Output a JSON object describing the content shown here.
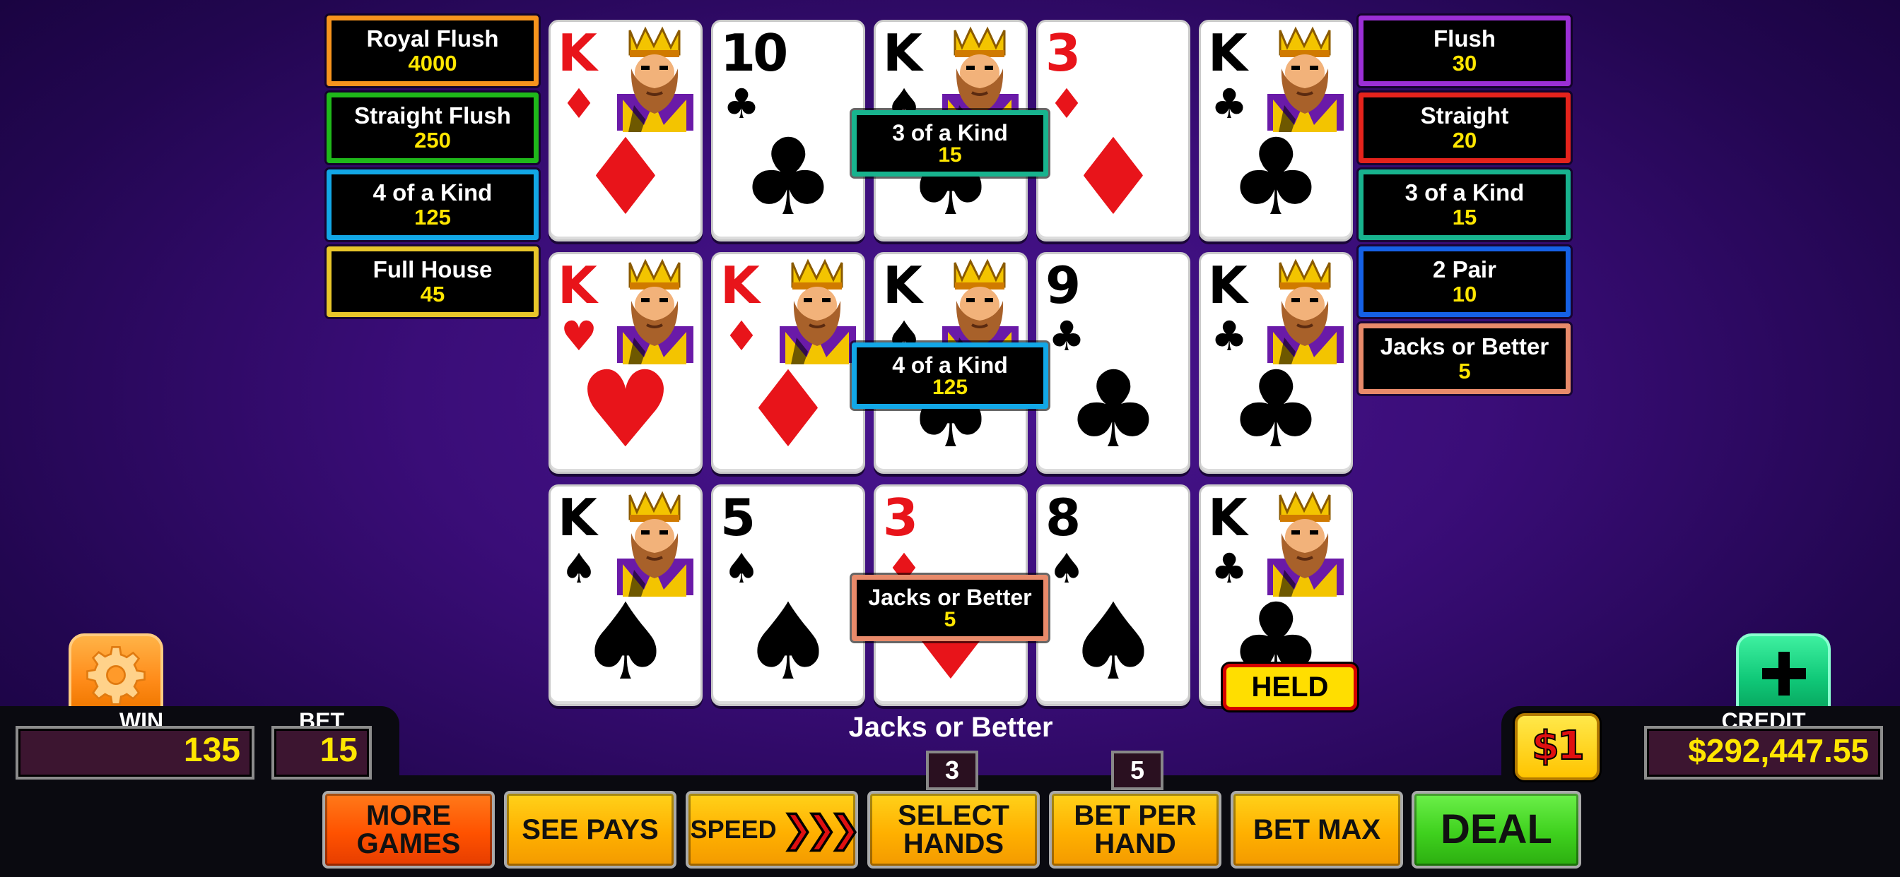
{
  "paytable_left": [
    {
      "name": "Royal Flush",
      "value": "4000",
      "color": "#f7941d"
    },
    {
      "name": "Straight Flush",
      "value": "250",
      "color": "#1fb81a"
    },
    {
      "name": "4 of a Kind",
      "value": "125",
      "color": "#12a7e6"
    },
    {
      "name": "Full House",
      "value": "45",
      "color": "#e8c62a"
    }
  ],
  "paytable_right": [
    {
      "name": "Flush",
      "value": "30",
      "color": "#9b2fd6"
    },
    {
      "name": "Straight",
      "value": "20",
      "color": "#e5231c"
    },
    {
      "name": "3 of a Kind",
      "value": "15",
      "color": "#18b38e"
    },
    {
      "name": "2 Pair",
      "value": "10",
      "color": "#1561e6"
    },
    {
      "name": "Jacks or Better",
      "value": "5",
      "color": "#e88a6a"
    }
  ],
  "hands": [
    {
      "cards": [
        {
          "rank": "K",
          "suit": "♦",
          "color": "red",
          "face": true
        },
        {
          "rank": "10",
          "suit": "♣",
          "color": "black",
          "face": false
        },
        {
          "rank": "K",
          "suit": "♠",
          "color": "black",
          "face": true
        },
        {
          "rank": "3",
          "suit": "♦",
          "color": "red",
          "face": false
        },
        {
          "rank": "K",
          "suit": "♣",
          "color": "black",
          "face": true
        }
      ],
      "result": {
        "name": "3 of a Kind",
        "value": "15",
        "color": "#18b38e"
      }
    },
    {
      "cards": [
        {
          "rank": "K",
          "suit": "♥",
          "color": "red",
          "face": true
        },
        {
          "rank": "K",
          "suit": "♦",
          "color": "red",
          "face": true
        },
        {
          "rank": "K",
          "suit": "♠",
          "color": "black",
          "face": true
        },
        {
          "rank": "9",
          "suit": "♣",
          "color": "black",
          "face": false
        },
        {
          "rank": "K",
          "suit": "♣",
          "color": "black",
          "face": true
        }
      ],
      "result": {
        "name": "4 of a Kind",
        "value": "125",
        "color": "#12a7e6"
      }
    },
    {
      "cards": [
        {
          "rank": "K",
          "suit": "♠",
          "color": "black",
          "face": true
        },
        {
          "rank": "5",
          "suit": "♠",
          "color": "black",
          "face": false
        },
        {
          "rank": "3",
          "suit": "♦",
          "color": "red",
          "face": false
        },
        {
          "rank": "8",
          "suit": "♠",
          "color": "black",
          "face": false
        },
        {
          "rank": "K",
          "suit": "♣",
          "color": "black",
          "face": true
        }
      ],
      "result": {
        "name": "Jacks or Better",
        "value": "5",
        "color": "#e88a6a"
      }
    }
  ],
  "held_label": "HELD",
  "game_name": "Jacks or Better",
  "meters": {
    "win_label": "WIN",
    "win": "135",
    "bet_label": "BET",
    "bet": "15",
    "credit_label": "CREDIT",
    "credit": "$292,447.55"
  },
  "denomination": "$1",
  "counters": {
    "hands": "3",
    "bet_per_hand": "5"
  },
  "buttons": {
    "more_games": "MORE GAMES",
    "see_pays": "SEE PAYS",
    "speed": "SPEED",
    "speed_arrows": "❯❯❯",
    "select_hands": "SELECT HANDS",
    "bet_per_hand": "BET PER HAND",
    "bet_max": "BET MAX",
    "deal": "DEAL"
  },
  "icons": {
    "settings": "gear-icon",
    "add_credits": "plus-icon"
  }
}
